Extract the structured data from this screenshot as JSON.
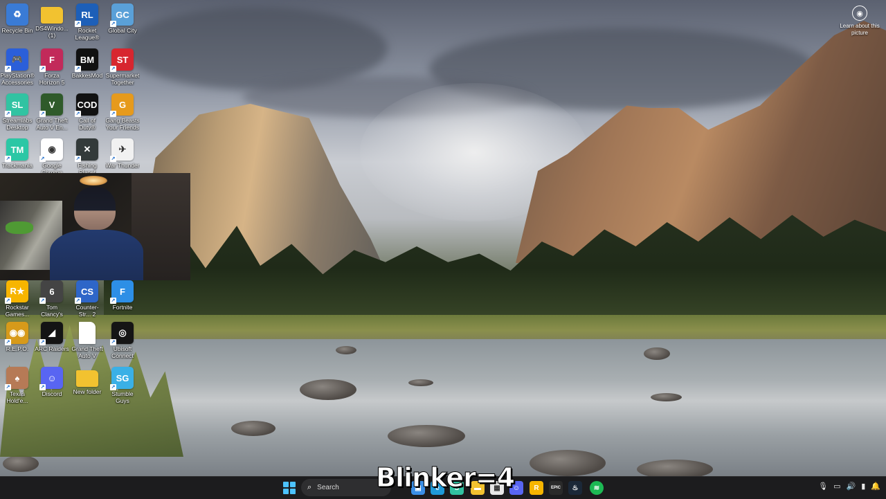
{
  "desktop": {
    "icons": [
      {
        "label": "Recycle Bin",
        "icon": "recycle-bin-icon",
        "color": "#3a7bd5",
        "glyph": "♻",
        "shortcut": false
      },
      {
        "label": "DS4Windo... (1)",
        "icon": "folder-icon",
        "color": "#f2c230",
        "glyph": "",
        "shortcut": false
      },
      {
        "label": "Rocket League®",
        "icon": "rocket-league-icon",
        "color": "#1d5fb8",
        "glyph": "RL",
        "shortcut": true
      },
      {
        "label": "Global City",
        "icon": "global-city-icon",
        "color": "#5aa0d8",
        "glyph": "GC",
        "shortcut": true
      },
      {
        "label": "PlayStation® Accessories",
        "icon": "playstation-accessories-icon",
        "color": "#2b5fd9",
        "glyph": "🎮",
        "shortcut": true
      },
      {
        "label": "Forza Horizon 5",
        "icon": "forza-horizon-icon",
        "color": "#c22a5a",
        "glyph": "F",
        "shortcut": true
      },
      {
        "label": "BakkesMod",
        "icon": "bakkesmod-icon",
        "color": "#111111",
        "glyph": "BM",
        "shortcut": true
      },
      {
        "label": "Supermarket Together",
        "icon": "supermarket-together-icon",
        "color": "#d7262f",
        "glyph": "ST",
        "shortcut": true
      },
      {
        "label": "Streamlabs Desktop",
        "icon": "streamlabs-icon",
        "color": "#31c3a2",
        "glyph": "SL",
        "shortcut": true
      },
      {
        "label": "Grand Theft Auto V En...",
        "icon": "gta-v-icon",
        "color": "#2f5a2a",
        "glyph": "V",
        "shortcut": true
      },
      {
        "label": "Call of Duty®",
        "icon": "call-of-duty-icon",
        "color": "#121212",
        "glyph": "COD",
        "shortcut": true
      },
      {
        "label": "Gang Beasts Your Friends",
        "icon": "gang-beasts-icon",
        "color": "#e69a1c",
        "glyph": "G",
        "shortcut": true
      },
      {
        "label": "Trackmania",
        "icon": "trackmania-icon",
        "color": "#2bc7a5",
        "glyph": "TM",
        "shortcut": true
      },
      {
        "label": "Google Chrome",
        "icon": "chrome-icon",
        "color": "#ffffff",
        "glyph": "◉",
        "shortcut": true
      },
      {
        "label": "Fishing Planet",
        "icon": "fishing-planet-icon",
        "color": "#333a3a",
        "glyph": "✕",
        "shortcut": true
      },
      {
        "label": "War Thunder",
        "icon": "war-thunder-icon",
        "color": "#f1f1f1",
        "glyph": "✈",
        "shortcut": true
      },
      {
        "label": "Rockstar Games...",
        "icon": "rockstar-icon",
        "color": "#f7b500",
        "glyph": "R★",
        "shortcut": true
      },
      {
        "label": "Tom Clancy's Rainbow Si...",
        "icon": "rainbow-six-icon",
        "color": "#444444",
        "glyph": "6",
        "shortcut": true
      },
      {
        "label": "Counter-Str... 2",
        "icon": "counter-strike-icon",
        "color": "#2e66c8",
        "glyph": "CS",
        "shortcut": true
      },
      {
        "label": "Fortnite",
        "icon": "fortnite-icon",
        "color": "#2d8fe6",
        "glyph": "F",
        "shortcut": true
      },
      {
        "label": "R.E.P.O.",
        "icon": "repo-icon",
        "color": "#d79a1a",
        "glyph": "◉◉",
        "shortcut": true
      },
      {
        "label": "ARC Raiders",
        "icon": "arc-raiders-icon",
        "color": "#141414",
        "glyph": "◢",
        "shortcut": true
      },
      {
        "label": "Grand Theft Auto V",
        "icon": "file-icon",
        "color": "#ffffff",
        "glyph": "",
        "shortcut": false
      },
      {
        "label": "Ubisoft Connect",
        "icon": "ubisoft-icon",
        "color": "#151515",
        "glyph": "◎",
        "shortcut": true
      },
      {
        "label": "Texas Hold'e...",
        "icon": "texas-holdem-icon",
        "color": "#b67a56",
        "glyph": "♠",
        "shortcut": true
      },
      {
        "label": "Discord",
        "icon": "discord-icon",
        "color": "#5865f2",
        "glyph": "☺",
        "shortcut": true
      },
      {
        "label": "New folder",
        "icon": "folder-icon",
        "color": "#f2c230",
        "glyph": "",
        "shortcut": false
      },
      {
        "label": "Stumble Guys",
        "icon": "stumble-guys-icon",
        "color": "#3ab0e6",
        "glyph": "SG",
        "shortcut": true
      }
    ]
  },
  "learn_about": {
    "label": "Learn about this picture",
    "icon": "camera-icon"
  },
  "overlay_text": "Blinker=4",
  "taskbar": {
    "start_icon": "windows-start-icon",
    "search_placeholder": "Search",
    "search_icon": "search-icon",
    "pinned_apps": [
      {
        "name": "task-view",
        "icon": "task-view-icon",
        "color": "#3a8ee6",
        "glyph": "▣"
      },
      {
        "name": "edge",
        "icon": "edge-icon",
        "color": "#1e9ad9",
        "glyph": "e"
      },
      {
        "name": "streamlabs",
        "icon": "streamlabs-icon",
        "color": "#31c3a2",
        "glyph": "S"
      },
      {
        "name": "file-explorer",
        "icon": "folder-icon",
        "color": "#f2c230",
        "glyph": "▬"
      },
      {
        "name": "microsoft-store",
        "icon": "store-icon",
        "color": "#e8e8e8",
        "glyph": "▦"
      },
      {
        "name": "discord",
        "icon": "discord-icon",
        "color": "#5865f2",
        "glyph": "☺"
      },
      {
        "name": "rockstar-launcher",
        "icon": "rockstar-icon",
        "color": "#f7b500",
        "glyph": "R"
      },
      {
        "name": "epic-games",
        "icon": "epic-games-icon",
        "color": "#2a2a2a",
        "glyph": "EPIC"
      },
      {
        "name": "steam",
        "icon": "steam-icon",
        "color": "#1b2838",
        "glyph": "♨"
      },
      {
        "name": "spotify",
        "icon": "spotify-icon",
        "color": "#1db954",
        "glyph": "≋"
      }
    ],
    "tray": [
      "microphone-icon",
      "display-icon",
      "volume-icon",
      "battery-icon",
      "notification-icon"
    ]
  }
}
